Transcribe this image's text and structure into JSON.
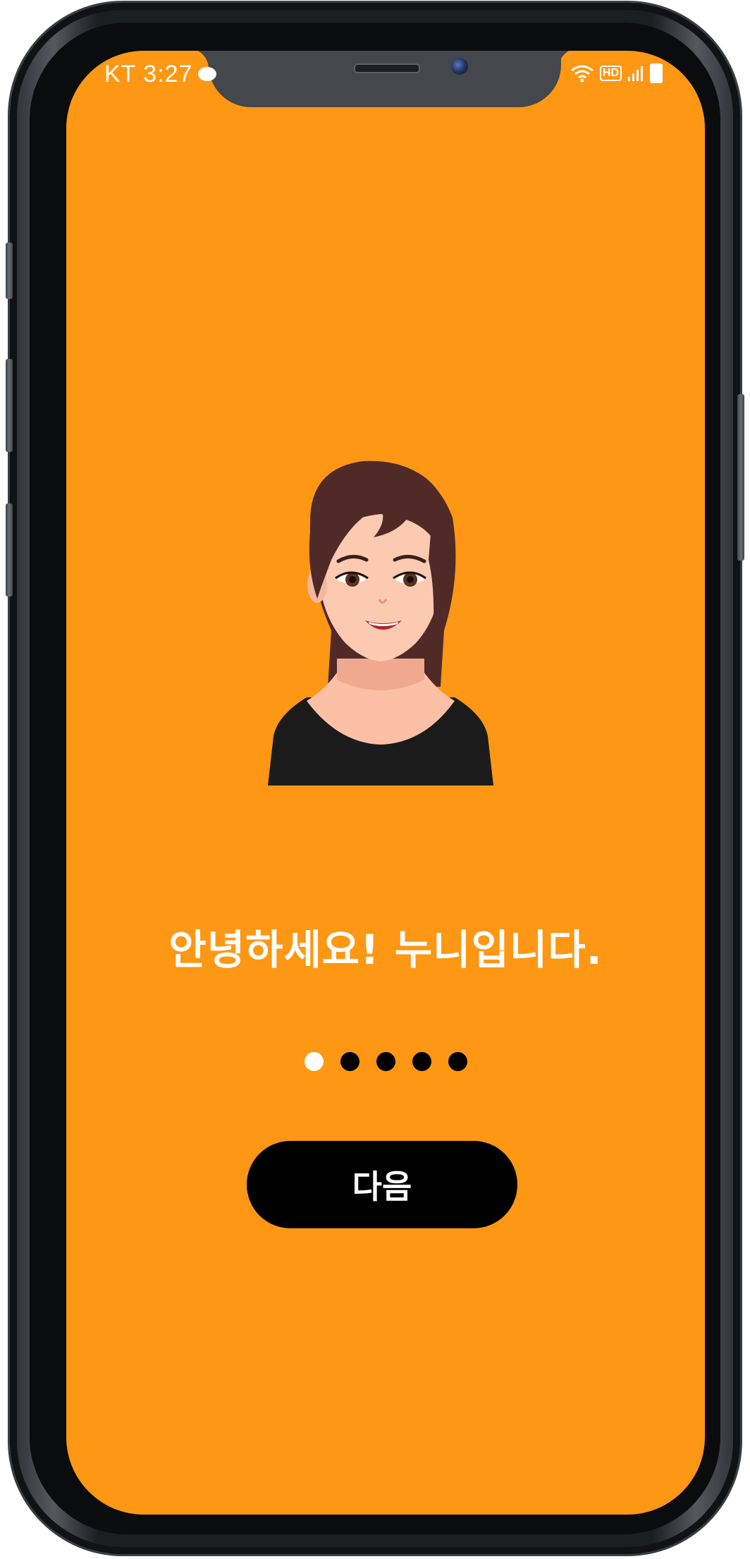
{
  "status_bar": {
    "carrier": "KT",
    "time": "3:27",
    "icons": [
      "message-icon",
      "wifi-icon",
      "hd-icon",
      "signal-icon",
      "battery-icon"
    ],
    "hd_label": "HD"
  },
  "onboarding": {
    "illustration": "woman-avatar",
    "greeting": "안녕하세요! 누니입니다.",
    "page_indicator": {
      "total": 5,
      "current": 1
    },
    "next_button_label": "다음"
  },
  "colors": {
    "background": "#fe9714",
    "button": "#000000",
    "text": "#ffffff",
    "dot_active": "#ffffff",
    "dot_inactive": "#000000"
  }
}
